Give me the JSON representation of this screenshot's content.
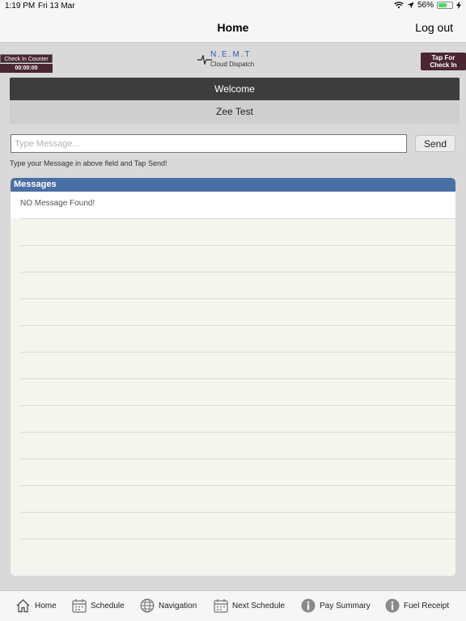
{
  "status_bar": {
    "time": "1:19 PM",
    "date": "Fri 13 Mar",
    "battery": "56%"
  },
  "nav": {
    "title": "Home",
    "logout": "Log out"
  },
  "checkin": {
    "counter_label": "Check In Counter",
    "counter_value": "00:00:00",
    "tap_line1": "Tap For",
    "tap_line2": "Check In"
  },
  "logo": {
    "brand": "N.E.M.T",
    "sub": "Cloud Dispatch"
  },
  "welcome": {
    "title": "Welcome",
    "user": "Zee Test"
  },
  "message": {
    "placeholder": "Type Message...",
    "send": "Send",
    "hint": "Type your Message in above field and Tap Send!"
  },
  "messages": {
    "header": "Messages",
    "empty": "NO Message Found!"
  },
  "tabs": [
    {
      "label": "Home",
      "icon": "home-icon"
    },
    {
      "label": "Schedule",
      "icon": "calendar-icon"
    },
    {
      "label": "Navigation",
      "icon": "globe-icon"
    },
    {
      "label": "Next Schedule",
      "icon": "calendar-icon"
    },
    {
      "label": "Pay Summary",
      "icon": "info-icon"
    },
    {
      "label": "Fuel Receipt",
      "icon": "info-icon"
    }
  ],
  "colors": {
    "accent": "#4a6fa5",
    "checkin": "#4a2630",
    "welcome": "#3d3d3d"
  }
}
